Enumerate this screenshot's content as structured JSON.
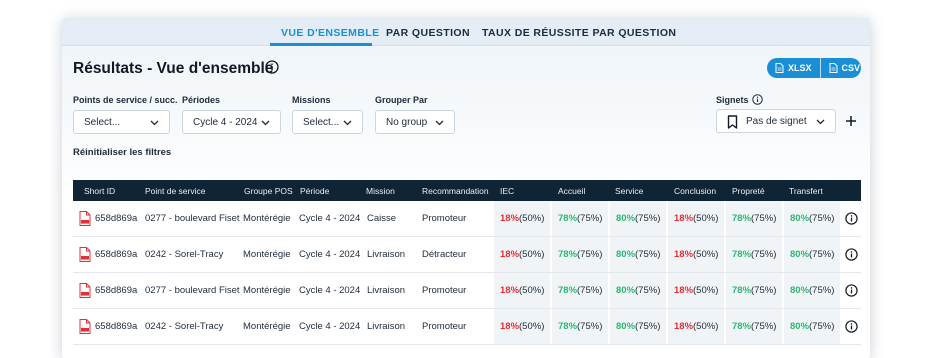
{
  "tabs": [
    {
      "label": "VUE D'ENSEMBLE",
      "active": true
    },
    {
      "label": "PAR QUESTION",
      "active": false
    },
    {
      "label": "TAUX DE RÉUSSITE PAR QUESTION",
      "active": false
    }
  ],
  "header": {
    "title": "Résultats - Vue d'ensemble",
    "export_xlsx": "XLSX",
    "export_csv": "CSV"
  },
  "filters": {
    "points": {
      "label": "Points de service / succ.",
      "value": "Select..."
    },
    "periodes": {
      "label": "Périodes",
      "value": "Cycle 4 - 2024"
    },
    "missions": {
      "label": "Missions",
      "value": "Select..."
    },
    "grouper": {
      "label": "Grouper Par",
      "value": "No group"
    },
    "reset": "Réinitialiser les filtres"
  },
  "signets": {
    "label": "Signets",
    "value": "Pas de signet"
  },
  "colors": {
    "accent": "#1a8fd6",
    "header_bg": "#0f2535",
    "low": "#e0303a",
    "high": "#2fb573"
  },
  "table": {
    "columns": [
      "Short ID",
      "Point de service",
      "Groupe POS",
      "Période",
      "Mission",
      "Recommandation",
      "IEC",
      "Accueil",
      "Service",
      "Conclusion",
      "Propreté",
      "Transfert"
    ],
    "rows": [
      {
        "id": "658d869a",
        "point": "0277 - boulevard Fiset",
        "groupe": "Montérégie",
        "periode": "Cycle 4 - 2024",
        "mission": "Caisse",
        "reco": "Promoteur",
        "scores": [
          [
            "18%",
            "(50%)",
            "red"
          ],
          [
            "78%",
            "(75%)",
            "green"
          ],
          [
            "80%",
            "(75%)",
            "green"
          ],
          [
            "18%",
            "(50%)",
            "red"
          ],
          [
            "78%",
            "(75%)",
            "green"
          ],
          [
            "80%",
            "(75%)",
            "green"
          ]
        ]
      },
      {
        "id": "658d869a",
        "point": "0242 - Sorel-Tracy",
        "groupe": "Montérégie",
        "periode": "Cycle 4 - 2024",
        "mission": "Livraison",
        "reco": "Détracteur",
        "scores": [
          [
            "18%",
            "(50%)",
            "red"
          ],
          [
            "78%",
            "(75%)",
            "green"
          ],
          [
            "80%",
            "(75%)",
            "green"
          ],
          [
            "18%",
            "(50%)",
            "red"
          ],
          [
            "78%",
            "(75%)",
            "green"
          ],
          [
            "80%",
            "(75%)",
            "green"
          ]
        ]
      },
      {
        "id": "658d869a",
        "point": "0277 - boulevard Fiset",
        "groupe": "Montérégie",
        "periode": "Cycle 4 - 2024",
        "mission": "Livraison",
        "reco": "Promoteur",
        "scores": [
          [
            "18%",
            "(50%)",
            "red"
          ],
          [
            "78%",
            "(75%)",
            "green"
          ],
          [
            "80%",
            "(75%)",
            "green"
          ],
          [
            "18%",
            "(50%)",
            "red"
          ],
          [
            "78%",
            "(75%)",
            "green"
          ],
          [
            "80%",
            "(75%)",
            "green"
          ]
        ]
      },
      {
        "id": "658d869a",
        "point": "0242 - Sorel-Tracy",
        "groupe": "Montérégie",
        "periode": "Cycle 4 - 2024",
        "mission": "Livraison",
        "reco": "Promoteur",
        "scores": [
          [
            "18%",
            "(50%)",
            "red"
          ],
          [
            "78%",
            "(75%)",
            "green"
          ],
          [
            "80%",
            "(75%)",
            "green"
          ],
          [
            "18%",
            "(50%)",
            "red"
          ],
          [
            "78%",
            "(75%)",
            "green"
          ],
          [
            "80%",
            "(75%)",
            "green"
          ]
        ]
      }
    ]
  }
}
